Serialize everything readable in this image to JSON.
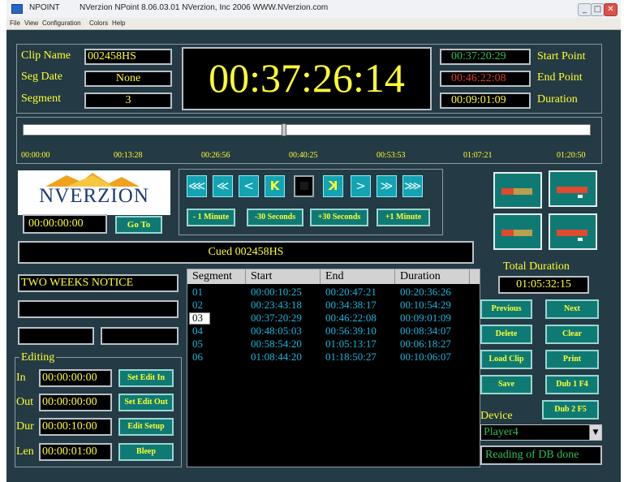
{
  "window": {
    "app_name": "NPOINT",
    "title": "NVerzion NPoint 8.06.03.01  NVerzion, Inc 2006   WWW.NVerzion.com",
    "controls": {
      "minimize": "_",
      "maximize": "□",
      "close": "✕"
    }
  },
  "menu": [
    "File",
    "View",
    "Configuration",
    "Colors",
    "Help"
  ],
  "clip_info": {
    "clip_name_label": "Clip Name",
    "clip_name": "002458HS",
    "seg_date_label": "Seg Date",
    "seg_date": "None",
    "segment_label": "Segment",
    "segment": "3"
  },
  "timecode": "00:37:26:14",
  "points": {
    "start_point": "00:37:20:29",
    "start_label": "Start Point",
    "end_point": "00:46:22:08",
    "end_label": "End Point",
    "duration": "00:09:01:09",
    "duration_label": "Duration"
  },
  "timeline": {
    "position": 0.46,
    "ticks": [
      "00:00:00",
      "00:13:28",
      "00:26:56",
      "00:40:25",
      "00:53:53",
      "01:07:21",
      "01:20:50"
    ]
  },
  "logo_text": "NVERZION",
  "goto": {
    "timecode": "00:00:00:00",
    "button": "Go To"
  },
  "transport": {
    "icons": [
      "rewind-to-start-icon",
      "fast-rewind-icon",
      "step-back-icon",
      "mark-in-icon",
      "stop-icon",
      "mark-out-icon",
      "step-forward-icon",
      "fast-forward-icon",
      "forward-to-end-icon"
    ],
    "glyphs": [
      "⋘",
      "≪",
      "<",
      "K",
      "■",
      "K",
      ">",
      "≫",
      "⋙"
    ]
  },
  "jump_buttons": [
    "- 1 Minute",
    "-30 Seconds",
    "+30 Seconds",
    "+1 Minute"
  ],
  "status_bar": "Cued 002458HS",
  "title_field": "TWO WEEKS NOTICE",
  "editing": {
    "label": "Editing",
    "in_label": "In",
    "in_value": "00:00:00:00",
    "set_edit_in": "Set Edit In",
    "out_label": "Out",
    "out_value": "00:00:00:00",
    "set_edit_out": "Set Edit Out",
    "dur_label": "Dur",
    "dur_value": "00:00:10:00",
    "edit_setup": "Edit Setup",
    "len_label": "Len",
    "len_value": "00:00:01:00",
    "bleep": "Bleep"
  },
  "segments_table": {
    "columns": [
      "Segment",
      "Start",
      "End",
      "Duration"
    ],
    "selected_index": 2,
    "rows": [
      [
        "01",
        "00:00:10:25",
        "00:20:47:21",
        "00:20:36:26"
      ],
      [
        "02",
        "00:23:43:18",
        "00:34:38:17",
        "00:10:54:29"
      ],
      [
        "03",
        "00:37:20:29",
        "00:46:22:08",
        "00:09:01:09"
      ],
      [
        "04",
        "00:48:05:03",
        "00:56:39:10",
        "00:08:34:07"
      ],
      [
        "05",
        "00:58:54:20",
        "01:05:13:17",
        "00:06:18:27"
      ],
      [
        "06",
        "01:08:44:20",
        "01:18:50:27",
        "00:10:06:07"
      ]
    ]
  },
  "total_duration": {
    "label": "Total Duration",
    "value": "01:05:32:15"
  },
  "right_buttons": {
    "previous": "Previous",
    "next": "Next",
    "delete": "Delete",
    "clear": "Clear",
    "load_clip": "Load Clip",
    "print": "Print",
    "save": "Save",
    "dub1": "Dub 1   F4",
    "dub2": "Dub 2   F5"
  },
  "device": {
    "label": "Device",
    "selected": "Player4",
    "status": "Reading of DB done"
  },
  "colors": {
    "background": "#243a44",
    "text": "#ffff30",
    "accent": "#13a3b3",
    "table_text": "#1ab7de",
    "button": "#0f7a74"
  }
}
